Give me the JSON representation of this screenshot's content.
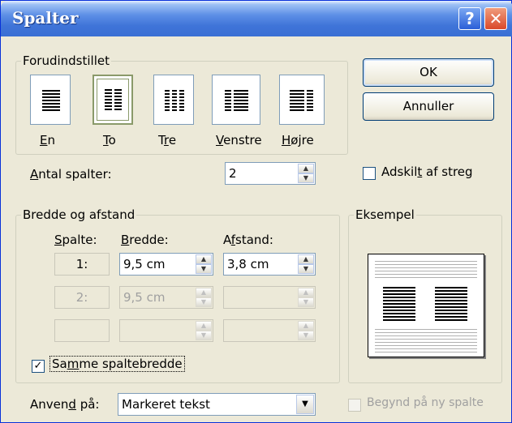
{
  "window": {
    "title": "Spalter",
    "help_label": "?",
    "close_label": "✕"
  },
  "presets": {
    "legend": "Forudindstillet",
    "items": [
      {
        "label": "En",
        "key": "E"
      },
      {
        "label": "To",
        "key": "T"
      },
      {
        "label": "Tre",
        "key": "r"
      },
      {
        "label": "Venstre",
        "key": "V"
      },
      {
        "label": "Højre",
        "key": "H"
      }
    ],
    "selected": "To"
  },
  "buttons": {
    "ok": "OK",
    "cancel": "Annuller"
  },
  "antal": {
    "label_pre": "",
    "label_key": "A",
    "label_post": "ntal spalter:",
    "value": "2"
  },
  "separator": {
    "label_pre": "Adskil",
    "label_key": "t",
    "label_post": " af streg",
    "checked": false
  },
  "width_spacing": {
    "legend": "Bredde og afstand",
    "headers": {
      "col_pre": "",
      "col_key": "S",
      "col_post": "palte:",
      "width_pre": "",
      "width_key": "B",
      "width_post": "redde:",
      "spacing_pre": "A",
      "spacing_key": "f",
      "spacing_post": "stand:"
    },
    "rows": [
      {
        "col": "1:",
        "width": "9,5 cm",
        "spacing": "3,8 cm"
      },
      {
        "col": "2:",
        "width": "9,5 cm",
        "spacing": ""
      },
      {
        "col": "",
        "width": "",
        "spacing": ""
      }
    ],
    "same_width": {
      "label_pre": "Sa",
      "label_key": "m",
      "label_post": "me spaltebredde",
      "checked": true
    }
  },
  "preview": {
    "legend": "Eksempel"
  },
  "apply": {
    "label_pre": "Anven",
    "label_key": "d",
    "label_post": " på:",
    "value": "Markeret tekst"
  },
  "new_column": {
    "label": "Begynd på ny spalte",
    "checked": false
  },
  "icons": {
    "spin_up": "▲",
    "spin_down": "▼",
    "dropdown": "▼",
    "check": "✓"
  }
}
